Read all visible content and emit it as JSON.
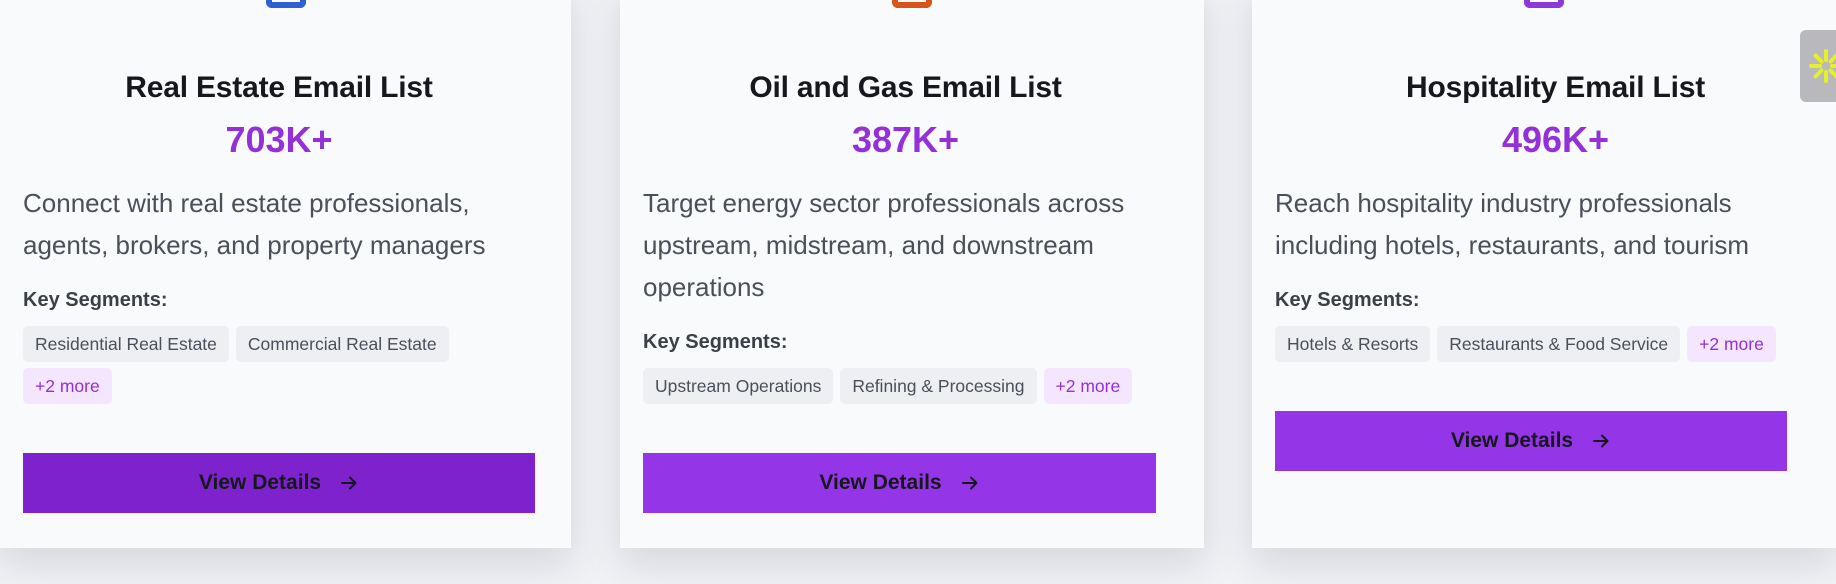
{
  "cards": [
    {
      "title": "Real Estate Email List",
      "count": "703K+",
      "description": "Connect with real estate professionals, agents, brokers, and property managers",
      "segments_label": "Key Segments:",
      "tags": [
        "Residential Real Estate",
        "Commercial Real Estate"
      ],
      "more": "+2 more",
      "button_label": "View Details",
      "icon": "building-icon",
      "icon_color": "#2f5fd0"
    },
    {
      "title": "Oil and Gas Email List",
      "count": "387K+",
      "description": "Target energy sector professionals across upstream, midstream, and downstream operations",
      "segments_label": "Key Segments:",
      "tags": [
        "Upstream Operations",
        "Refining & Processing"
      ],
      "more": "+2 more",
      "button_label": "View Details",
      "icon": "oil-icon",
      "icon_color": "#d8541a"
    },
    {
      "title": "Hospitality Email List",
      "count": "496K+",
      "description": "Reach hospitality industry professionals including hotels, restaurants, and tourism",
      "segments_label": "Key Segments:",
      "tags": [
        "Hotels & Resorts",
        "Restaurants & Food Service"
      ],
      "more": "+2 more",
      "button_label": "View Details",
      "icon": "hotel-icon",
      "icon_color": "#8b3ad8"
    }
  ],
  "colors": {
    "accent": "#9330d8",
    "button": "#9436e8",
    "button_active": "#7e22ce",
    "tag_more_bg": "#f4e6ff"
  },
  "widget": {
    "icon": "sparkle-icon",
    "color": "#e6f02a"
  }
}
